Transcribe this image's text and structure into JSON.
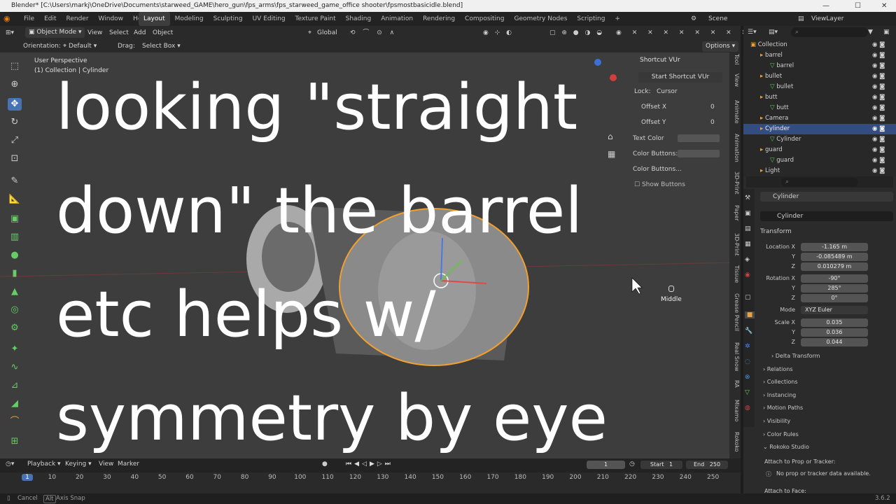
{
  "window": {
    "title": "Blender* [C:\\Users\\markj\\OneDrive\\Documents\\starweed_GAME\\hero_gun\\fps_arms\\fps_starweed_game_office shooter\\fpsmostbasicidle.blend]",
    "min": "—",
    "max": "☐",
    "close": "✕"
  },
  "menu": [
    "File",
    "Edit",
    "Render",
    "Window",
    "Help"
  ],
  "workspaces": [
    "Layout",
    "Modeling",
    "Sculpting",
    "UV Editing",
    "Texture Paint",
    "Shading",
    "Animation",
    "Rendering",
    "Compositing",
    "Geometry Nodes",
    "Scripting"
  ],
  "workspace_add": "+",
  "scene": {
    "label": "Scene",
    "viewlayer": "ViewLayer"
  },
  "viewport_header": {
    "mode": "Object Mode",
    "menus": [
      "View",
      "Select",
      "Add",
      "Object"
    ],
    "transform_orientation": "Global"
  },
  "tool_settings": {
    "orientation_label": "Orientation:",
    "orientation_value": "Default",
    "drag_label": "Drag:",
    "drag_value": "Select Box",
    "options": "Options"
  },
  "viewport_info": {
    "perspective": "User Perspective",
    "collection": "(1) Collection | Cylinder"
  },
  "npanel": {
    "title": "Shortcut VUr",
    "button": "Start Shortcut VUr",
    "lock_label": "Lock:",
    "lock_value": "Cursor",
    "offset_x": "Offset X",
    "offset_y": "Offset Y",
    "offset_val": "0",
    "text_color": "Text Color",
    "color_buttons": "Color Buttons:",
    "color_buttons2": "Color Buttons...",
    "show_buttons": "Show Buttons"
  },
  "key_indicator": "Middle",
  "side_tabs": [
    "Tool",
    "View",
    "Animate",
    "Animation",
    "3D-Print",
    "Paper",
    "3D-Print",
    "Tissue",
    "Grease Pencil",
    "Real Snow",
    "RA",
    "Mixamo",
    "Rokoko"
  ],
  "outliner": {
    "rows": [
      {
        "label": "Collection",
        "indent": 0
      },
      {
        "label": "barrel",
        "indent": 1
      },
      {
        "label": "barrel",
        "indent": 2
      },
      {
        "label": "bullet",
        "indent": 1
      },
      {
        "label": "bullet",
        "indent": 2
      },
      {
        "label": "butt",
        "indent": 1
      },
      {
        "label": "butt",
        "indent": 2
      },
      {
        "label": "Camera",
        "indent": 1
      },
      {
        "label": "Cylinder",
        "indent": 1,
        "selected": true
      },
      {
        "label": "Cylinder",
        "indent": 2
      },
      {
        "label": "guard",
        "indent": 1
      },
      {
        "label": "guard",
        "indent": 2
      },
      {
        "label": "Light",
        "indent": 1
      }
    ]
  },
  "properties": {
    "object_name": "Cylinder",
    "mesh_name": "Cylinder",
    "transform": "Transform",
    "location_label": "Location X",
    "location": [
      "-1.165 m",
      "-0.085489 m",
      "0.010279 m"
    ],
    "rotation_label": "Rotation X",
    "rotation": [
      "-90°",
      "285°",
      "0°"
    ],
    "mode_label": "Mode",
    "mode_value": "XYZ Euler",
    "scale_label": "Scale X",
    "scale": [
      "0.035",
      "0.036",
      "0.044"
    ],
    "axis_y": "Y",
    "axis_z": "Z",
    "sections": [
      "Delta Transform",
      "Relations",
      "Collections",
      "Instancing",
      "Motion Paths",
      "Visibility",
      "Color Rules",
      "Rokoko Studio"
    ],
    "attach_prop": "Attach to Prop or Tracker:",
    "no_prop": "No prop or tracker data available.",
    "attach_face": "Attach to Face:"
  },
  "timeline": {
    "menus": [
      "Playback",
      "Keying",
      "View",
      "Marker"
    ],
    "current_frame": "1",
    "start_label": "Start",
    "start": "1",
    "end_label": "End",
    "end": "250",
    "ticks": [
      "1",
      "10",
      "20",
      "30",
      "40",
      "50",
      "60",
      "70",
      "80",
      "90",
      "100",
      "110",
      "120",
      "130",
      "140",
      "150",
      "160",
      "170",
      "180",
      "190",
      "200",
      "210",
      "220",
      "230",
      "240",
      "250"
    ]
  },
  "statusbar": {
    "cancel": "Cancel",
    "axis_snap_key": "Alt",
    "axis_snap": "Axis Snap",
    "version": "3.6.2"
  },
  "overlay_text": {
    "line1": "looking \"straight",
    "line2": "down\" the barrel",
    "line3": "etc helps w/",
    "line4": "symmetry by eye"
  },
  "colors": {
    "accent": "#4772b3",
    "selection": "#f0a030",
    "viewport": "#3d3d3d"
  }
}
